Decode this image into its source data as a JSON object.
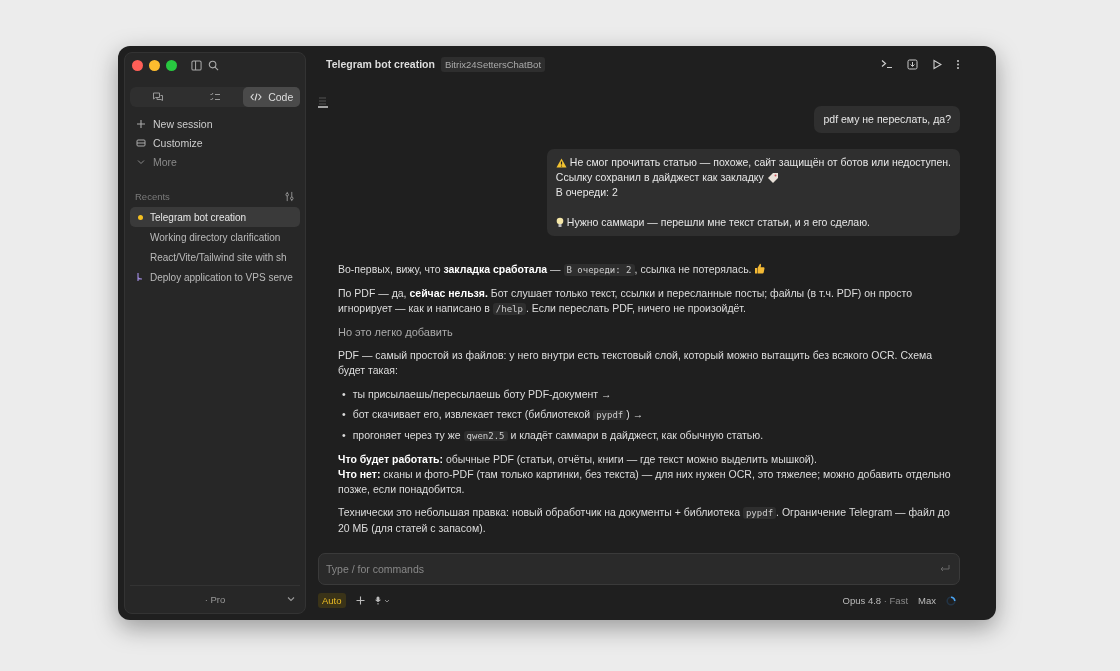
{
  "sidebar": {
    "tabs": [
      {
        "kind": "chat",
        "selected": false
      },
      {
        "kind": "tasks",
        "selected": false
      },
      {
        "kind": "code",
        "label": "Code",
        "selected": true
      }
    ],
    "nav": [
      {
        "kind": "plus",
        "label": "New session"
      },
      {
        "kind": "box",
        "label": "Customize"
      },
      {
        "kind": "chevron",
        "label": "More"
      }
    ],
    "recents_label": "Recents",
    "recents": [
      {
        "label": "Telegram bot creation",
        "selected": true,
        "kind": "dot"
      },
      {
        "label": "Working directory clarification",
        "selected": false,
        "kind": "none"
      },
      {
        "label": "React/Vite/Tailwind site with sh",
        "selected": false,
        "kind": "none"
      },
      {
        "label": "Deploy application to VPS serve",
        "selected": false,
        "kind": "branch"
      }
    ],
    "plan": "· Pro"
  },
  "header": {
    "title": "Telegram bot creation",
    "project": "Bitrix24SettersChatBot"
  },
  "messages": [
    {
      "lines": [
        {
          "kind": "plain",
          "text": "pdf ему не переслать, да?"
        }
      ]
    },
    {
      "lines": [
        {
          "kind": "warning",
          "text": "Не смог прочитать статью — похоже, сайт защищён от ботов или недоступен."
        },
        {
          "kind": "tag",
          "text": "Ссылку сохранил в дайджест как закладку"
        },
        {
          "kind": "plain",
          "text": "В очереди: 2"
        },
        {
          "kind": "blank"
        },
        {
          "kind": "bulb",
          "text": "Нужно саммари — перешли мне текст статьи, и я его сделаю."
        }
      ]
    }
  ],
  "response": [
    {
      "kind": "para",
      "lines": [
        [
          {
            "kind": "text",
            "text": "Во-первых, вижу, что **закладка сработала** — "
          },
          {
            "kind": "code",
            "text": "В очереди: 2"
          },
          {
            "kind": "text",
            "text": ", ссылка не потерялась."
          },
          {
            "kind": "thumbs"
          }
        ]
      ]
    },
    {
      "kind": "para",
      "lines": [
        [
          {
            "kind": "text",
            "text": "По PDF — да, **сейчас нельзя.** Бот слушает только текст, ссылки и пересланные посты; файлы (в т.ч. PDF) он просто игнорирует — как и написано в "
          },
          {
            "kind": "code",
            "text": "/help"
          },
          {
            "kind": "text",
            "text": ". Если переслать PDF, ничего не произойдёт."
          }
        ]
      ]
    },
    {
      "kind": "heading",
      "text": "Но это легко добавить"
    },
    {
      "kind": "para",
      "lines": [
        [
          {
            "kind": "text",
            "text": "PDF — самый простой из файлов: у него внутри есть текстовый слой, который можно вытащить без всякого OCR. Схема будет такая:"
          }
        ]
      ]
    },
    {
      "kind": "list",
      "marker": "•",
      "lines": [
        [
          {
            "kind": "text",
            "text": "ты присылаешь/пересылаешь боту PDF-документ →"
          }
        ],
        [
          {
            "kind": "text",
            "text": "бот скачивает его, извлекает текст (библиотекой "
          },
          {
            "kind": "code",
            "text": "pypdf"
          },
          {
            "kind": "text",
            "text": ") →"
          }
        ],
        [
          {
            "kind": "text",
            "text": "прогоняет через ту же "
          },
          {
            "kind": "code",
            "text": "qwen2.5"
          },
          {
            "kind": "text",
            "text": " и кладёт саммари в дайджест, как обычную статью."
          }
        ]
      ]
    },
    {
      "kind": "para",
      "lines": [
        [
          {
            "kind": "text",
            "text": "**Что будет работать:** обычные PDF (статьи, отчёты, книги — где текст можно выделить мышкой)."
          }
        ],
        [
          {
            "kind": "text",
            "text": "**Что нет:** сканы и фото-PDF (там только картинки, без текста) — для них нужен OCR, это тяжелее; можно добавить отдельно позже, если понадобится."
          }
        ]
      ]
    },
    {
      "kind": "para",
      "lines": [
        [
          {
            "kind": "text",
            "text": "Технически это небольшая правка: новый обработчик на документы + библиотека "
          },
          {
            "kind": "code",
            "text": "pypdf"
          },
          {
            "kind": "text",
            "text": ". Ограничение Telegram — файл до 20 МБ (для статей с запасом)."
          }
        ]
      ]
    }
  ],
  "composer": {
    "placeholder": "Type / for commands",
    "mode": "Auto",
    "model": "Opus 4.8",
    "speed": "· Fast",
    "effort": "Max"
  }
}
